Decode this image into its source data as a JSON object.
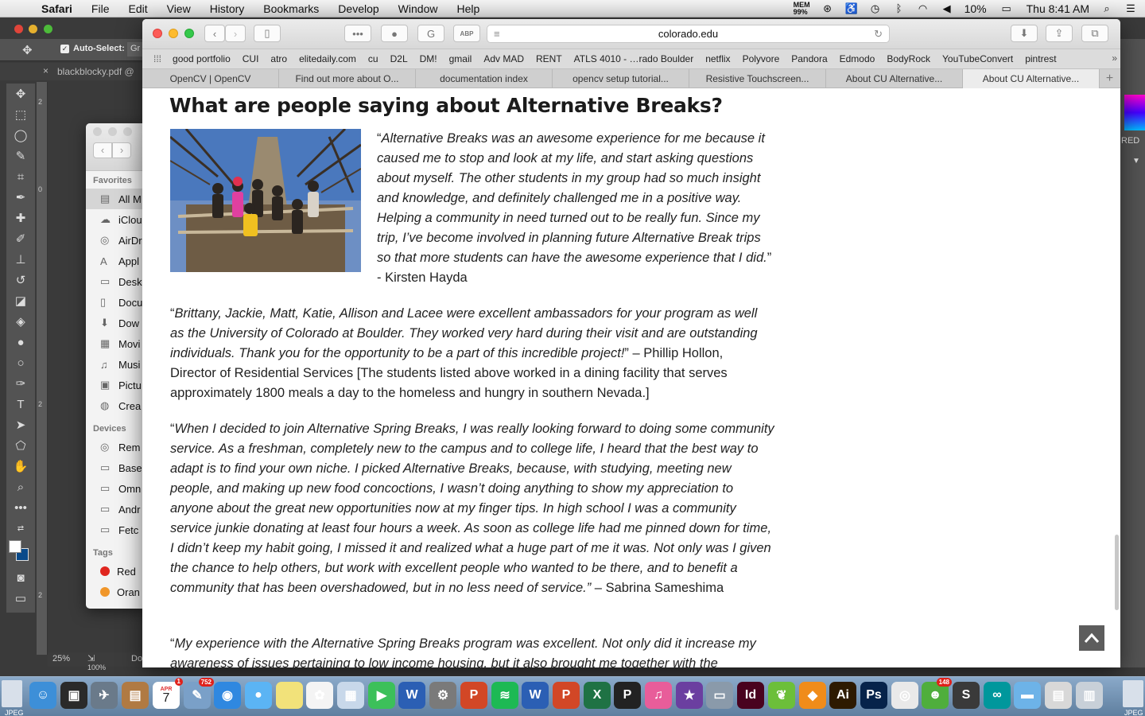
{
  "menubar": {
    "app": "Safari",
    "items": [
      "File",
      "Edit",
      "View",
      "History",
      "Bookmarks",
      "Develop",
      "Window",
      "Help"
    ],
    "mem_label": "MEM",
    "mem_value": "99%",
    "battery": "10%",
    "clock": "Thu 8:41 AM"
  },
  "photoshop": {
    "options_label": "Auto-Select:",
    "options_value": "Gr",
    "doc_tab": "blackblocky.pdf @",
    "zoom_top": "25%",
    "zoom_bottom": "100%",
    "doc_label": "Do",
    "right_label": "RED",
    "ruler_marks": [
      "2",
      "0",
      "2",
      "2"
    ]
  },
  "finder": {
    "favorites_label": "Favorites",
    "favorites": [
      {
        "label": "All M",
        "icon": "all-my-files-icon",
        "glyph": "▤",
        "selected": true
      },
      {
        "label": "iClou",
        "icon": "icloud-icon",
        "glyph": "☁"
      },
      {
        "label": "AirDr",
        "icon": "airdrop-icon",
        "glyph": "◎"
      },
      {
        "label": "Appl",
        "icon": "applications-icon",
        "glyph": "A"
      },
      {
        "label": "Desk",
        "icon": "desktop-icon",
        "glyph": "▭"
      },
      {
        "label": "Docu",
        "icon": "documents-icon",
        "glyph": "▯"
      },
      {
        "label": "Dow",
        "icon": "downloads-icon",
        "glyph": "⬇"
      },
      {
        "label": "Movi",
        "icon": "movies-icon",
        "glyph": "▦"
      },
      {
        "label": "Musi",
        "icon": "music-icon",
        "glyph": "♫"
      },
      {
        "label": "Pictu",
        "icon": "pictures-icon",
        "glyph": "▣"
      },
      {
        "label": "Crea",
        "icon": "creative-cloud-icon",
        "glyph": "◍"
      }
    ],
    "devices_label": "Devices",
    "devices": [
      {
        "label": "Rem",
        "icon": "remote-disc-icon",
        "glyph": "◎"
      },
      {
        "label": "Base",
        "icon": "drive-icon",
        "glyph": "▭"
      },
      {
        "label": "Omn",
        "icon": "drive-icon",
        "glyph": "▭"
      },
      {
        "label": "Andr",
        "icon": "drive-icon",
        "glyph": "▭"
      },
      {
        "label": "Fetc",
        "icon": "drive-icon",
        "glyph": "▭"
      }
    ],
    "tags_label": "Tags",
    "tags": [
      {
        "label": "Red",
        "color": "#e0261f"
      },
      {
        "label": "Oran",
        "color": "#f0962a"
      }
    ]
  },
  "safari": {
    "url": "colorado.edu",
    "bookmarks": [
      "good portfolio",
      "CUI",
      "atro",
      "elitedaily.com",
      "cu",
      "D2L",
      "DM!",
      "gmail",
      "Adv MAD",
      "RENT",
      "ATLS 4010 - …rado Boulder",
      "netflix",
      "Polyvore",
      "Pandora",
      "Edmodo",
      "BodyRock",
      "YouTubeConvert",
      "pintrest"
    ],
    "tabs": [
      "OpenCV | OpenCV",
      "Find out more about O...",
      "documentation index",
      "opencv setup tutorial...",
      "Resistive Touchscreen...",
      "About CU Alternative...",
      "About CU Alternative..."
    ],
    "active_tab": 6
  },
  "page": {
    "heading": "What are people saying about Alternative Breaks?",
    "quotes": [
      {
        "open": "“",
        "text": "Alternative Breaks was an awesome experience for me because it caused me to stop and look at my life, and start asking questions about myself.  The other students in my group had so much insight and knowledge, and definitely challenged me in a positive way.  Helping a community in need turned out to be really fun. Since my trip, I’ve become involved in planning future Alternative Break trips so that more students can have the awesome experience that I did.",
        "close": "”",
        "attribution": "  - Kirsten Hayda"
      },
      {
        "open": "“",
        "text": "Brittany, Jackie, Matt, Katie, Allison and Lacee were excellent ambassadors for your program as well as the University of Colorado at Boulder. They worked very hard during their visit and are outstanding individuals. Thank you for the opportunity to be a part of this incredible project!",
        "close": "”",
        "attribution": " – Phillip Hollon, Director of Residential Services [The students listed above worked in a dining facility that serves approximately 1800 meals a day to the homeless and hungry in southern Nevada.]"
      },
      {
        "open": "“",
        "text": "When I decided to join Alternative Spring Breaks, I was really looking forward to doing some community service.  As a freshman, completely new to the campus and to college life, I heard that the best way to adapt is to find your own niche.  I picked Alternative Breaks, because, with studying, meeting new people, and making up new food concoctions, I wasn’t doing anything to show my appreciation to anyone about the great new opportunities now at my finger tips.  In high school I was a community service junkie donating at least four hours a week.  As soon as college life had me pinned down for time, I didn’t keep my habit going, I missed it and realized what a huge part of me it was.  Not only was I given the chance to help others, but work with excellent people who wanted to be there, and to benefit a community that has been overshadowed, but in no less need of service.”",
        "close": "",
        "attribution": "   – Sabrina Sameshima"
      },
      {
        "open": "“",
        "text": "My experience with the Alternative Spring Breaks program was excellent. Not only did it increase my awareness of issues pertaining to low income housing, but it also brought me together with the",
        "close": "",
        "attribution": ""
      }
    ]
  },
  "dock": {
    "calendar_month": "APR",
    "calendar_day": "7",
    "badges": {
      "calendar": "1",
      "preview": "752",
      "chat": "148"
    },
    "jpeg_label": "JPEG",
    "items": [
      {
        "name": "finder-icon",
        "color": "#3d8fd8",
        "glyph": "☺"
      },
      {
        "name": "photo-booth-icon",
        "color": "#2a2a2a",
        "glyph": "▣"
      },
      {
        "name": "launchpad-icon",
        "color": "#6a7a8a",
        "glyph": "✈"
      },
      {
        "name": "contacts-icon",
        "color": "#b07a43",
        "glyph": "▤"
      },
      {
        "name": "calendar-icon",
        "color": "#ffffff",
        "glyph": ""
      },
      {
        "name": "preview-icon",
        "color": "#7aa0c8",
        "glyph": "✎"
      },
      {
        "name": "safari-icon",
        "color": "#2f88e0",
        "glyph": "◉"
      },
      {
        "name": "messages-icon",
        "color": "#5bb4f4",
        "glyph": "●"
      },
      {
        "name": "stickies-icon",
        "color": "#f2e27a",
        "glyph": ""
      },
      {
        "name": "photos-icon",
        "color": "#f4f4f4",
        "glyph": "✿"
      },
      {
        "name": "photo-editor-icon",
        "color": "#c8d8ea",
        "glyph": "▦"
      },
      {
        "name": "facetime-icon",
        "color": "#3cc05a",
        "glyph": "▶"
      },
      {
        "name": "word-icon",
        "color": "#2b5fb4",
        "glyph": "W"
      },
      {
        "name": "system-preferences-icon",
        "color": "#7a7a7a",
        "glyph": "⚙"
      },
      {
        "name": "powerpoint-icon",
        "color": "#d24726",
        "glyph": "P"
      },
      {
        "name": "spotify-icon",
        "color": "#1db954",
        "glyph": "≋"
      },
      {
        "name": "word-icon",
        "color": "#2b5fb4",
        "glyph": "W"
      },
      {
        "name": "powerpoint-icon",
        "color": "#d24726",
        "glyph": "P"
      },
      {
        "name": "excel-icon",
        "color": "#1f7244",
        "glyph": "X"
      },
      {
        "name": "pages-icon",
        "color": "#222222",
        "glyph": "P"
      },
      {
        "name": "itunes-icon",
        "color": "#e85d9a",
        "glyph": "♫"
      },
      {
        "name": "imovie-icon",
        "color": "#6b3fa0",
        "glyph": "★"
      },
      {
        "name": "image-capture-icon",
        "color": "#8a9aaa",
        "glyph": "▭"
      },
      {
        "name": "indesign-icon",
        "color": "#49021f",
        "glyph": "Id"
      },
      {
        "name": "leaf-app-icon",
        "color": "#6cbf3a",
        "glyph": "❦"
      },
      {
        "name": "vlc-icon",
        "color": "#f08c1a",
        "glyph": "◆"
      },
      {
        "name": "illustrator-icon",
        "color": "#2d1a00",
        "glyph": "Ai"
      },
      {
        "name": "photoshop-icon",
        "color": "#06234a",
        "glyph": "Ps"
      },
      {
        "name": "chrome-icon",
        "color": "#e9e9e9",
        "glyph": "◎"
      },
      {
        "name": "chat-icon",
        "color": "#4fae3c",
        "glyph": "☻"
      },
      {
        "name": "sublime-text-icon",
        "color": "#3a3a3a",
        "glyph": "S"
      },
      {
        "name": "arduino-icon",
        "color": "#00979c",
        "glyph": "∞"
      },
      {
        "name": "folder-icon",
        "color": "#6db3e8",
        "glyph": "▬"
      },
      {
        "name": "documents-stack-icon",
        "color": "#d8d8d8",
        "glyph": "▤"
      },
      {
        "name": "trash-icon",
        "color": "#c8d0d8",
        "glyph": "▥"
      }
    ]
  }
}
